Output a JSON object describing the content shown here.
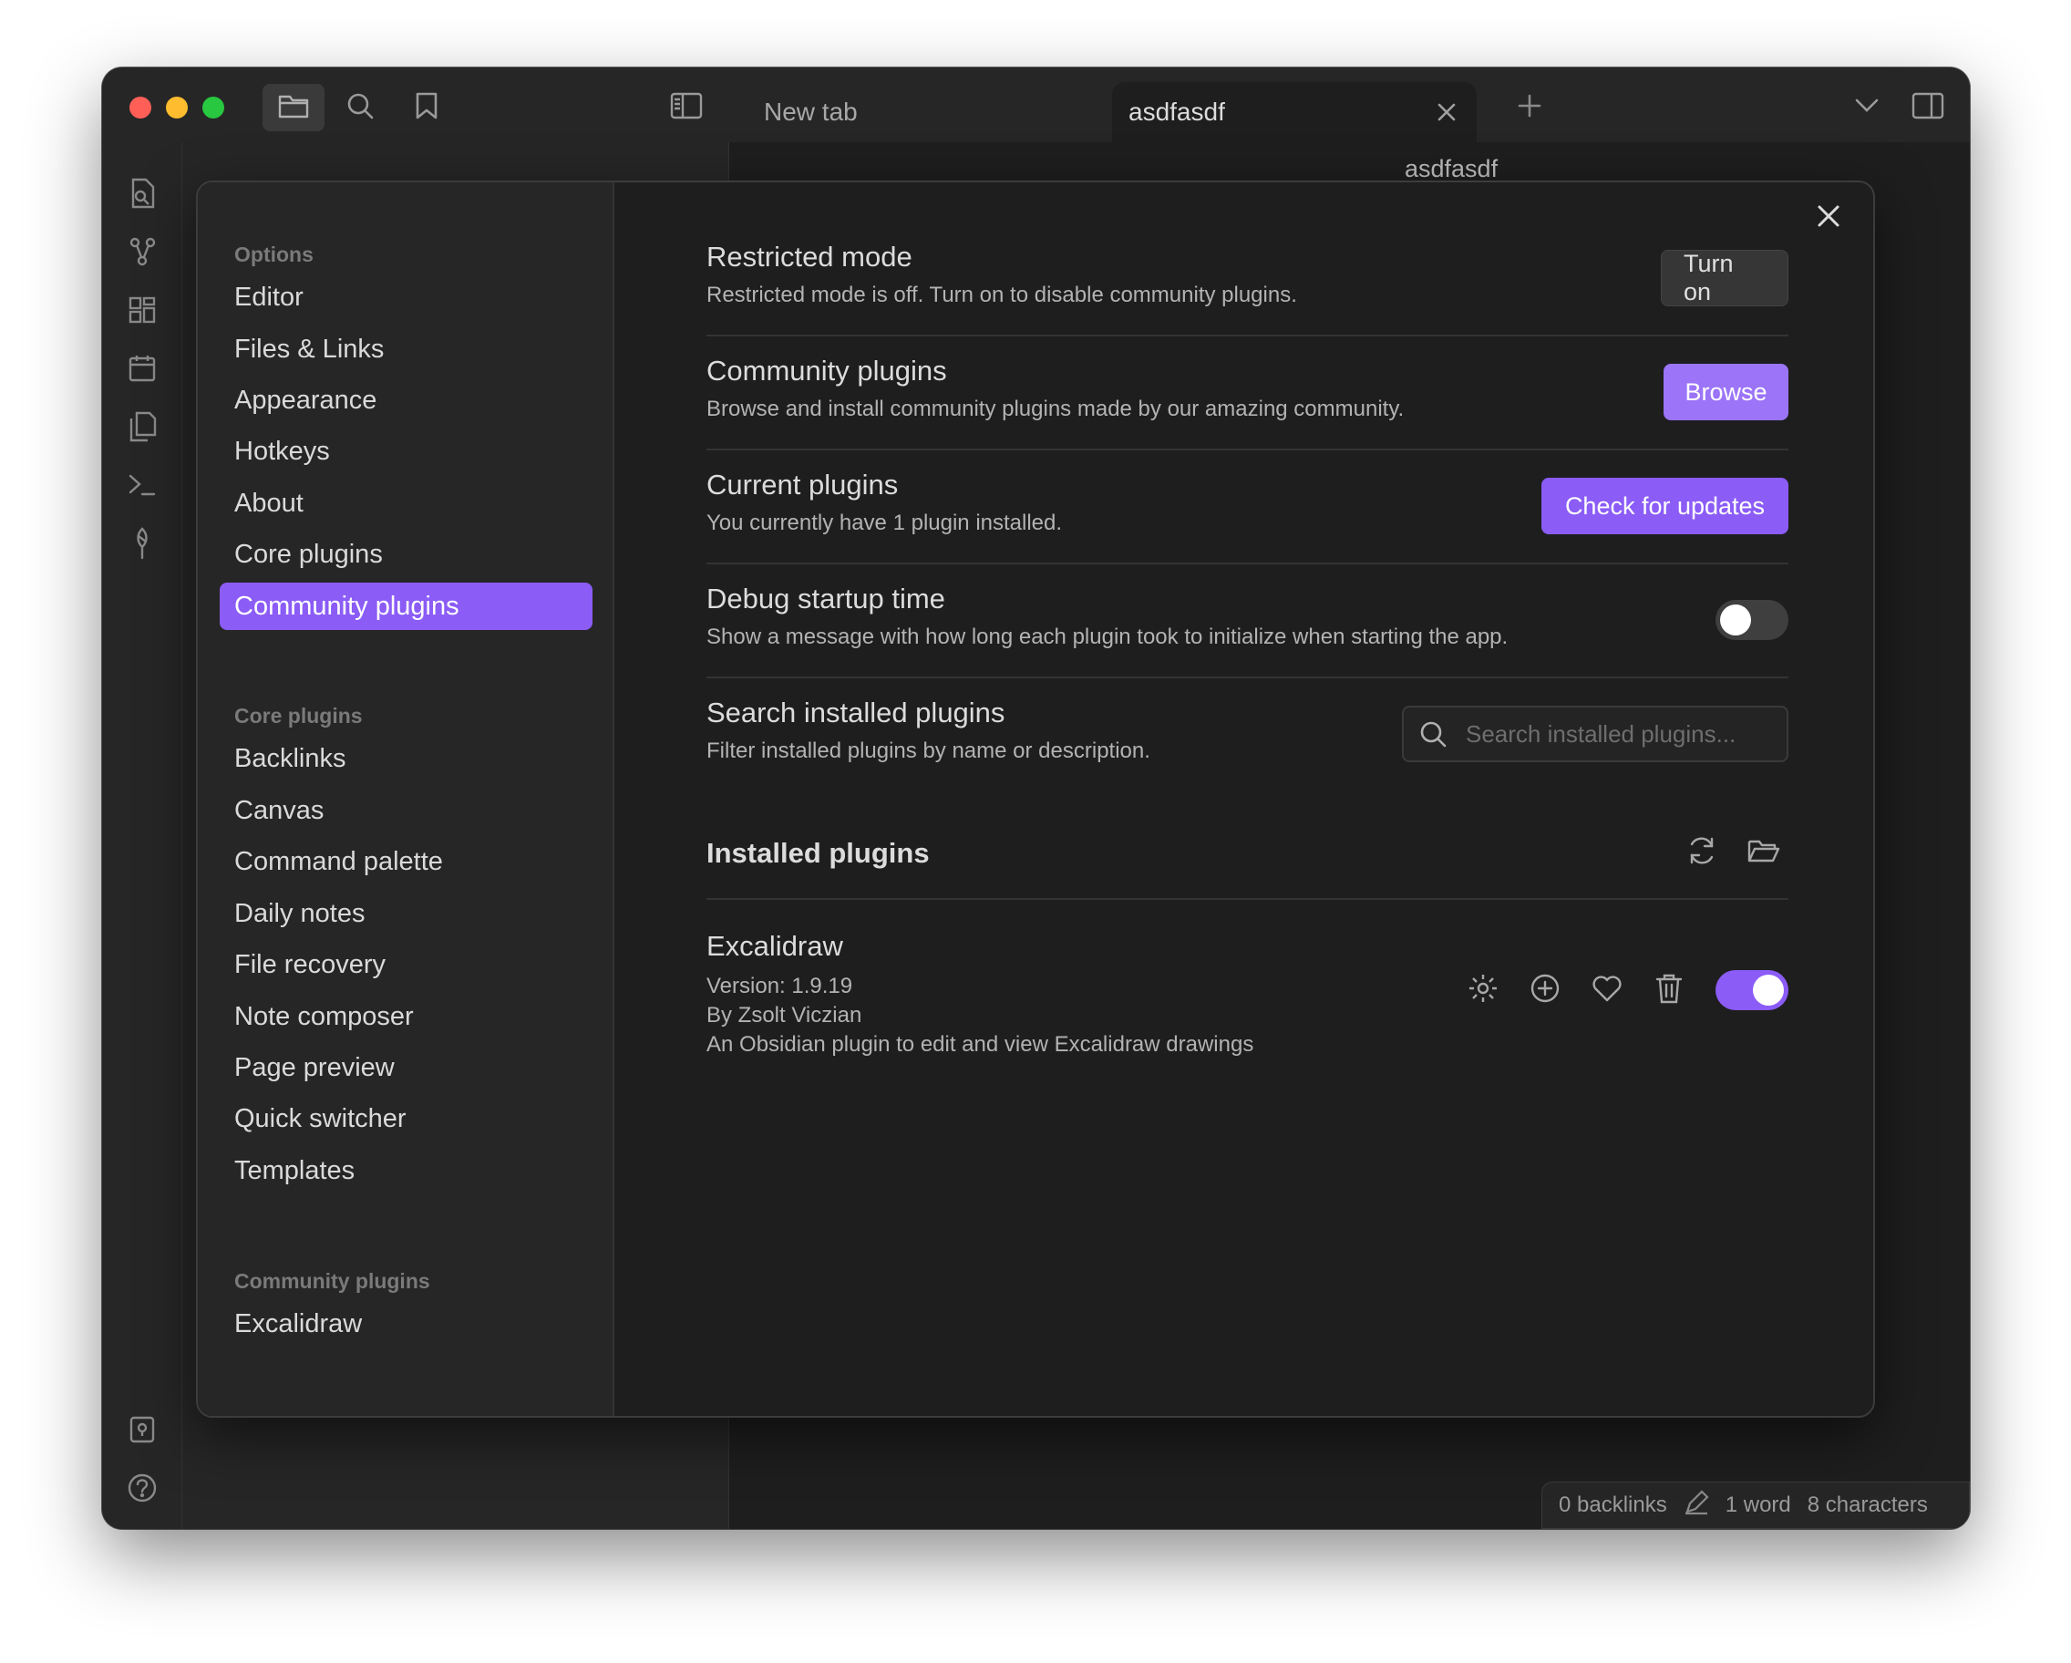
{
  "tabs": {
    "new_tab": "New tab",
    "active_tab": "asdfasdf"
  },
  "editor": {
    "header_title": "asdfasdf"
  },
  "status_bar": {
    "backlinks": "0 backlinks",
    "words": "1 word",
    "characters": "8 characters"
  },
  "settings_nav": {
    "options_heading": "Options",
    "options": [
      "Editor",
      "Files & Links",
      "Appearance",
      "Hotkeys",
      "About",
      "Core plugins",
      "Community plugins"
    ],
    "active_item": "Community plugins",
    "core_heading": "Core plugins",
    "core_items": [
      "Backlinks",
      "Canvas",
      "Command palette",
      "Daily notes",
      "File recovery",
      "Note composer",
      "Page preview",
      "Quick switcher",
      "Templates"
    ],
    "community_heading": "Community plugins",
    "community_items": [
      "Excalidraw"
    ]
  },
  "restricted_mode": {
    "name": "Restricted mode",
    "desc": "Restricted mode is off. Turn on to disable community plugins.",
    "button": "Turn on"
  },
  "community_plugins": {
    "name": "Community plugins",
    "desc": "Browse and install community plugins made by our amazing community.",
    "button": "Browse"
  },
  "current_plugins": {
    "name": "Current plugins",
    "desc": "You currently have 1 plugin installed.",
    "button": "Check for updates"
  },
  "debug_startup": {
    "name": "Debug startup time",
    "desc": "Show a message with how long each plugin took to initialize when starting the app.",
    "enabled": false
  },
  "search_installed": {
    "name": "Search installed plugins",
    "desc": "Filter installed plugins by name or description.",
    "placeholder": "Search installed plugins..."
  },
  "installed": {
    "heading": "Installed plugins",
    "plugin": {
      "name": "Excalidraw",
      "version": "Version: 1.9.19",
      "author": "By Zsolt Viczian",
      "description": "An Obsidian plugin to edit and view Excalidraw drawings",
      "enabled": true
    }
  },
  "colors": {
    "accent": "#8b5cf6",
    "background": "#1e1e1e",
    "panel": "#262626"
  }
}
